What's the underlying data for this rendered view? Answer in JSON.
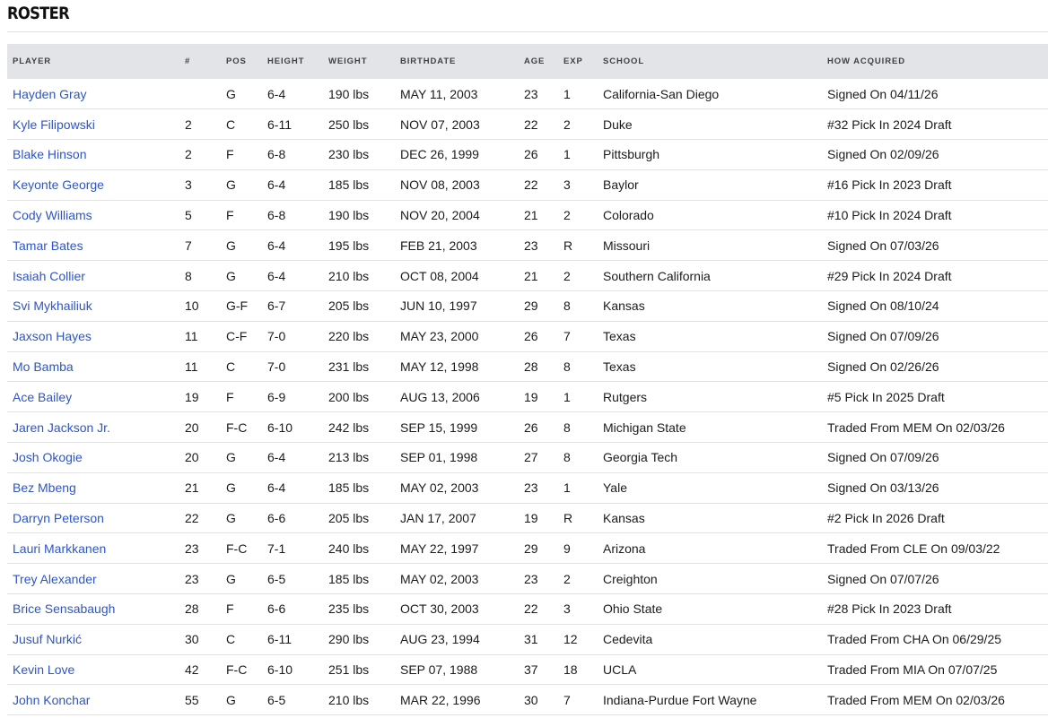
{
  "section": {
    "title": "ROSTER"
  },
  "columns": [
    "PLAYER",
    "#",
    "POS",
    "HEIGHT",
    "WEIGHT",
    "BIRTHDATE",
    "AGE",
    "EXP",
    "SCHOOL",
    "HOW ACQUIRED"
  ],
  "players": [
    {
      "name": "Hayden Gray",
      "number": "",
      "pos": "G",
      "height": "6-4",
      "weight": "190 lbs",
      "birthdate": "MAY 11, 2003",
      "age": "23",
      "exp": "1",
      "school": "California-San Diego",
      "acquired": "Signed On 04/11/26"
    },
    {
      "name": "Kyle Filipowski",
      "number": "2",
      "pos": "C",
      "height": "6-11",
      "weight": "250 lbs",
      "birthdate": "NOV 07, 2003",
      "age": "22",
      "exp": "2",
      "school": "Duke",
      "acquired": "#32 Pick In 2024 Draft"
    },
    {
      "name": "Blake Hinson",
      "number": "2",
      "pos": "F",
      "height": "6-8",
      "weight": "230 lbs",
      "birthdate": "DEC 26, 1999",
      "age": "26",
      "exp": "1",
      "school": "Pittsburgh",
      "acquired": "Signed On 02/09/26"
    },
    {
      "name": "Keyonte George",
      "number": "3",
      "pos": "G",
      "height": "6-4",
      "weight": "185 lbs",
      "birthdate": "NOV 08, 2003",
      "age": "22",
      "exp": "3",
      "school": "Baylor",
      "acquired": "#16 Pick In 2023 Draft"
    },
    {
      "name": "Cody Williams",
      "number": "5",
      "pos": "F",
      "height": "6-8",
      "weight": "190 lbs",
      "birthdate": "NOV 20, 2004",
      "age": "21",
      "exp": "2",
      "school": "Colorado",
      "acquired": "#10 Pick In 2024 Draft"
    },
    {
      "name": "Tamar Bates",
      "number": "7",
      "pos": "G",
      "height": "6-4",
      "weight": "195 lbs",
      "birthdate": "FEB 21, 2003",
      "age": "23",
      "exp": "R",
      "school": "Missouri",
      "acquired": "Signed On 07/03/26"
    },
    {
      "name": "Isaiah Collier",
      "number": "8",
      "pos": "G",
      "height": "6-4",
      "weight": "210 lbs",
      "birthdate": "OCT 08, 2004",
      "age": "21",
      "exp": "2",
      "school": "Southern California",
      "acquired": "#29 Pick In 2024 Draft"
    },
    {
      "name": "Svi Mykhailiuk",
      "number": "10",
      "pos": "G-F",
      "height": "6-7",
      "weight": "205 lbs",
      "birthdate": "JUN 10, 1997",
      "age": "29",
      "exp": "8",
      "school": "Kansas",
      "acquired": "Signed On 08/10/24"
    },
    {
      "name": "Jaxson Hayes",
      "number": "11",
      "pos": "C-F",
      "height": "7-0",
      "weight": "220 lbs",
      "birthdate": "MAY 23, 2000",
      "age": "26",
      "exp": "7",
      "school": "Texas",
      "acquired": "Signed On 07/09/26"
    },
    {
      "name": "Mo Bamba",
      "number": "11",
      "pos": "C",
      "height": "7-0",
      "weight": "231 lbs",
      "birthdate": "MAY 12, 1998",
      "age": "28",
      "exp": "8",
      "school": "Texas",
      "acquired": "Signed On 02/26/26"
    },
    {
      "name": "Ace Bailey",
      "number": "19",
      "pos": "F",
      "height": "6-9",
      "weight": "200 lbs",
      "birthdate": "AUG 13, 2006",
      "age": "19",
      "exp": "1",
      "school": "Rutgers",
      "acquired": "#5 Pick In 2025 Draft"
    },
    {
      "name": "Jaren Jackson Jr.",
      "number": "20",
      "pos": "F-C",
      "height": "6-10",
      "weight": "242 lbs",
      "birthdate": "SEP 15, 1999",
      "age": "26",
      "exp": "8",
      "school": "Michigan State",
      "acquired": "Traded From MEM On 02/03/26"
    },
    {
      "name": "Josh Okogie",
      "number": "20",
      "pos": "G",
      "height": "6-4",
      "weight": "213 lbs",
      "birthdate": "SEP 01, 1998",
      "age": "27",
      "exp": "8",
      "school": "Georgia Tech",
      "acquired": "Signed On 07/09/26"
    },
    {
      "name": "Bez Mbeng",
      "number": "21",
      "pos": "G",
      "height": "6-4",
      "weight": "185 lbs",
      "birthdate": "MAY 02, 2003",
      "age": "23",
      "exp": "1",
      "school": "Yale",
      "acquired": "Signed On 03/13/26"
    },
    {
      "name": "Darryn Peterson",
      "number": "22",
      "pos": "G",
      "height": "6-6",
      "weight": "205 lbs",
      "birthdate": "JAN 17, 2007",
      "age": "19",
      "exp": "R",
      "school": "Kansas",
      "acquired": "#2 Pick In 2026 Draft"
    },
    {
      "name": "Lauri Markkanen",
      "number": "23",
      "pos": "F-C",
      "height": "7-1",
      "weight": "240 lbs",
      "birthdate": "MAY 22, 1997",
      "age": "29",
      "exp": "9",
      "school": "Arizona",
      "acquired": "Traded From CLE On 09/03/22"
    },
    {
      "name": "Trey Alexander",
      "number": "23",
      "pos": "G",
      "height": "6-5",
      "weight": "185 lbs",
      "birthdate": "MAY 02, 2003",
      "age": "23",
      "exp": "2",
      "school": "Creighton",
      "acquired": "Signed On 07/07/26"
    },
    {
      "name": "Brice Sensabaugh",
      "number": "28",
      "pos": "F",
      "height": "6-6",
      "weight": "235 lbs",
      "birthdate": "OCT 30, 2003",
      "age": "22",
      "exp": "3",
      "school": "Ohio State",
      "acquired": "#28 Pick In 2023 Draft"
    },
    {
      "name": "Jusuf Nurkić",
      "number": "30",
      "pos": "C",
      "height": "6-11",
      "weight": "290 lbs",
      "birthdate": "AUG 23, 1994",
      "age": "31",
      "exp": "12",
      "school": "Cedevita",
      "acquired": "Traded From CHA On 06/29/25"
    },
    {
      "name": "Kevin Love",
      "number": "42",
      "pos": "F-C",
      "height": "6-10",
      "weight": "251 lbs",
      "birthdate": "SEP 07, 1988",
      "age": "37",
      "exp": "18",
      "school": "UCLA",
      "acquired": "Traded From MIA On 07/07/25"
    },
    {
      "name": "John Konchar",
      "number": "55",
      "pos": "G",
      "height": "6-5",
      "weight": "210 lbs",
      "birthdate": "MAR 22, 1996",
      "age": "30",
      "exp": "7",
      "school": "Indiana-Purdue Fort Wayne",
      "acquired": "Traded From MEM On 02/03/26"
    }
  ]
}
